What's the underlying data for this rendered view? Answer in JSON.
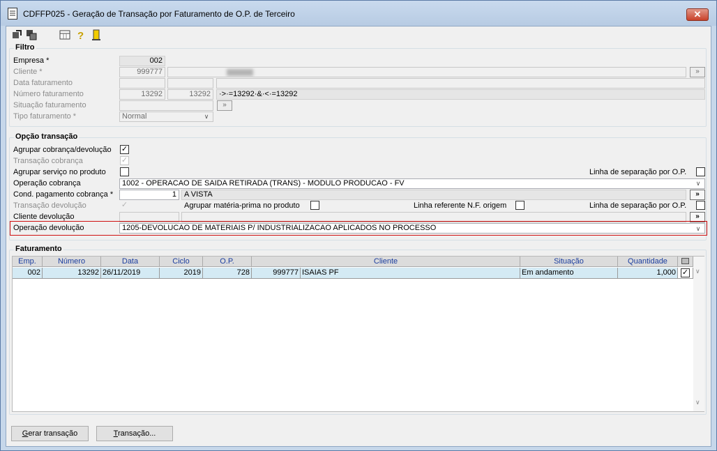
{
  "window": {
    "title": "CDFFP025 - Geração de Transação por Faturamento de O.P. de Terceiro",
    "close": "✕"
  },
  "colors": {
    "highlight": "#d01010",
    "selected_row": "#d4eaf4",
    "header_text": "#1a3d9e"
  },
  "filtro": {
    "title": "Filtro",
    "empresa_label": "Empresa *",
    "empresa_value": "002",
    "cliente_label": "Cliente *",
    "cliente_value": "999777",
    "data_label": "Data faturamento",
    "numero_label": "Número faturamento",
    "numero_from": "13292",
    "numero_to": "13292",
    "numero_expr": "·>·=13292·&·<·=13292",
    "situacao_label": "Situação faturamento",
    "tipo_label": "Tipo faturamento *",
    "tipo_value": "Normal",
    "more": "»"
  },
  "opcao": {
    "title": "Opção transação",
    "agrupar_cob_label": "Agrupar cobrança/devolução",
    "transacao_cob_label": "Transação cobrança",
    "agrupar_serv_label": "Agrupar serviço no produto",
    "linha_sep_label": "Linha de separação por O.P.",
    "operacao_cob_label": "Operação cobrança",
    "operacao_cob_value": "1002 - OPERACAO DE SAIDA RETIRADA (TRANS) - MODULO PRODUCAO - FV",
    "cond_pag_label": "Cond. pagamento cobrança *",
    "cond_pag_code": "1",
    "cond_pag_desc": "A VISTA",
    "transacao_dev_label": "Transação devolução",
    "agrupar_mp_label": "Agrupar matéria-prima no produto",
    "linha_ref_label": "Linha referente N.F. origem",
    "linha_sep2_label": "Linha de separação por O.P.",
    "cliente_dev_label": "Cliente devolução",
    "operacao_dev_label": "Operação devolução",
    "operacao_dev_value": "1205-DEVOLUCAO DE MATERIAIS P/ INDUSTRIALIZACAO APLICADOS NO PROCESSO",
    "more": "»",
    "check": "✓",
    "arrow": "∨"
  },
  "faturamento": {
    "title": "Faturamento",
    "columns": [
      "Emp.",
      "Número",
      "Data",
      "Ciclo",
      "O.P.",
      "Cliente",
      "Situação",
      "Quantidade"
    ],
    "row": {
      "emp": "002",
      "numero": "13292",
      "data": "26/11/2019",
      "ciclo": "2019",
      "op": "728",
      "cliente_code": "999777",
      "cliente_name": "ISAIAS PF",
      "situacao": "Em andamento",
      "quantidade": "1,000"
    }
  },
  "buttons": {
    "gerar_u": "G",
    "gerar_rest": "erar transação",
    "transacao_u": "T",
    "transacao_rest": "ransação..."
  }
}
